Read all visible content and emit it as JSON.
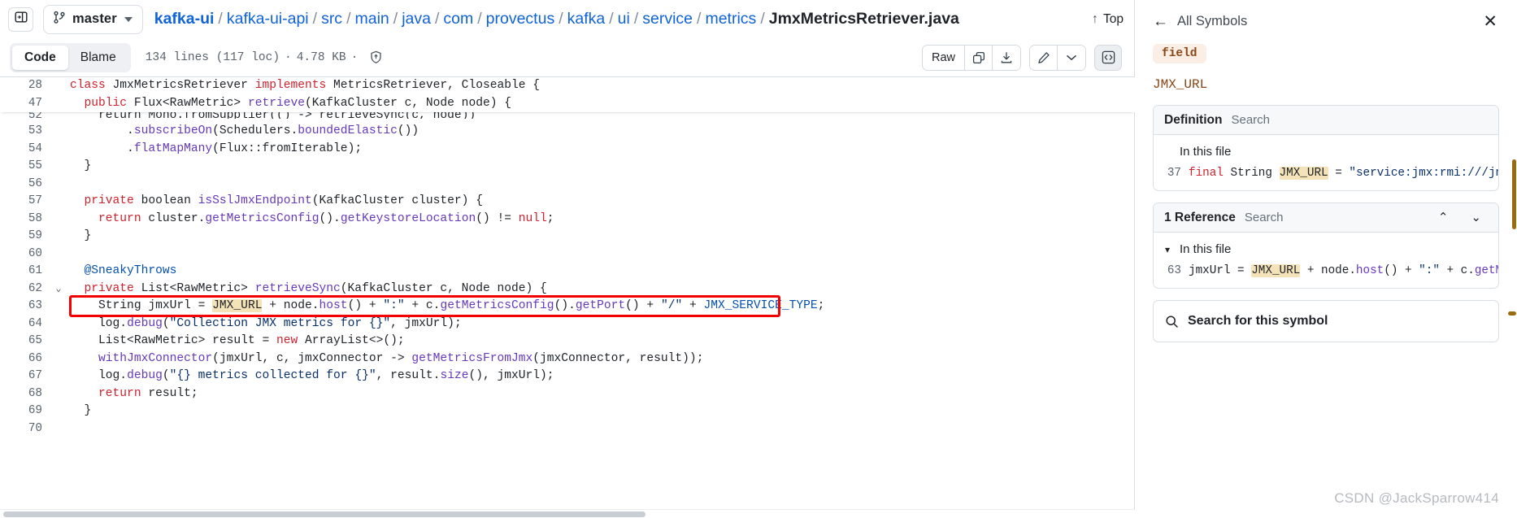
{
  "header": {
    "sidebar_toggle_icon": "sidebar-panel-icon",
    "branch": {
      "icon": "git-branch-icon",
      "name": "master",
      "caret_icon": "chevron-down-icon"
    },
    "breadcrumb": [
      {
        "label": "kafka-ui",
        "style": "bold-link"
      },
      {
        "label": "kafka-ui-api",
        "style": "link"
      },
      {
        "label": "src",
        "style": "link"
      },
      {
        "label": "main",
        "style": "link"
      },
      {
        "label": "java",
        "style": "link"
      },
      {
        "label": "com",
        "style": "link"
      },
      {
        "label": "provectus",
        "style": "link"
      },
      {
        "label": "kafka",
        "style": "link"
      },
      {
        "label": "ui",
        "style": "link"
      },
      {
        "label": "service",
        "style": "link"
      },
      {
        "label": "metrics",
        "style": "link"
      }
    ],
    "separator": "/",
    "filename": "JmxMetricsRetriever.java",
    "top_link": {
      "icon": "arrow-up-icon",
      "label": "Top"
    }
  },
  "toolbar": {
    "tabs": [
      {
        "label": "Code",
        "active": true
      },
      {
        "label": "Blame",
        "active": false
      }
    ],
    "meta": {
      "lines": "134 lines (117 loc)",
      "separator": "·",
      "size": "4.78 KB",
      "shield_icon": "shield-check-icon"
    },
    "actions": [
      {
        "name": "raw-button",
        "label": "Raw",
        "icon": null
      },
      {
        "name": "copy-raw-button",
        "label": "",
        "icon": "copy-icon"
      },
      {
        "name": "download-button",
        "label": "",
        "icon": "download-icon"
      },
      {
        "name": "edit-button",
        "label": "",
        "icon": "pencil-icon"
      },
      {
        "name": "edit-dropdown-button",
        "label": "",
        "icon": "chevron-down-icon"
      },
      {
        "name": "symbols-button",
        "label": "",
        "icon": "code-brackets-icon"
      }
    ]
  },
  "code": {
    "sticky_lines": [
      {
        "number": "28",
        "fold": "",
        "tokens": [
          {
            "t": "class ",
            "c": "k"
          },
          {
            "t": "JmxMetricsRetriever ",
            "c": "ty"
          },
          {
            "t": "implements ",
            "c": "k"
          },
          {
            "t": "MetricsRetriever, Closeable {",
            "c": "ty"
          }
        ]
      },
      {
        "number": "47",
        "fold": "",
        "tokens": [
          {
            "t": "  ",
            "c": "ty"
          },
          {
            "t": "public ",
            "c": "k"
          },
          {
            "t": "Flux<RawMetric> ",
            "c": "ty"
          },
          {
            "t": "retrieve",
            "c": "fn"
          },
          {
            "t": "(KafkaCluster c, Node node) {",
            "c": "ty"
          }
        ]
      }
    ],
    "clipped_line": {
      "number": "52",
      "tokens": [
        {
          "t": "    return Mono.fromSupplier(() -> retrieveSync(c, node))",
          "c": "ty"
        }
      ]
    },
    "lines": [
      {
        "number": "53",
        "fold": "",
        "tokens": [
          {
            "t": "        .",
            "c": "ty"
          },
          {
            "t": "subscribeOn",
            "c": "fn"
          },
          {
            "t": "(Schedulers.",
            "c": "ty"
          },
          {
            "t": "boundedElastic",
            "c": "fn"
          },
          {
            "t": "())",
            "c": "ty"
          }
        ]
      },
      {
        "number": "54",
        "fold": "",
        "tokens": [
          {
            "t": "        .",
            "c": "ty"
          },
          {
            "t": "flatMapMany",
            "c": "fn"
          },
          {
            "t": "(Flux::fromIterable);",
            "c": "ty"
          }
        ]
      },
      {
        "number": "55",
        "fold": "",
        "tokens": [
          {
            "t": "  }",
            "c": "ty"
          }
        ]
      },
      {
        "number": "56",
        "fold": "",
        "tokens": [
          {
            "t": "",
            "c": "ty"
          }
        ]
      },
      {
        "number": "57",
        "fold": "",
        "tokens": [
          {
            "t": "  ",
            "c": "ty"
          },
          {
            "t": "private ",
            "c": "k"
          },
          {
            "t": "boolean ",
            "c": "ty"
          },
          {
            "t": "isSslJmxEndpoint",
            "c": "fn"
          },
          {
            "t": "(KafkaCluster cluster) {",
            "c": "ty"
          }
        ]
      },
      {
        "number": "58",
        "fold": "",
        "tokens": [
          {
            "t": "    ",
            "c": "ty"
          },
          {
            "t": "return ",
            "c": "k"
          },
          {
            "t": "cluster.",
            "c": "ty"
          },
          {
            "t": "getMetricsConfig",
            "c": "fn"
          },
          {
            "t": "().",
            "c": "ty"
          },
          {
            "t": "getKeystoreLocation",
            "c": "fn"
          },
          {
            "t": "() != ",
            "c": "ty"
          },
          {
            "t": "null",
            "c": "k"
          },
          {
            "t": ";",
            "c": "ty"
          }
        ]
      },
      {
        "number": "59",
        "fold": "",
        "tokens": [
          {
            "t": "  }",
            "c": "ty"
          }
        ]
      },
      {
        "number": "60",
        "fold": "",
        "tokens": [
          {
            "t": "",
            "c": "ty"
          }
        ]
      },
      {
        "number": "61",
        "fold": "",
        "tokens": [
          {
            "t": "  @SneakyThrows",
            "c": "an"
          }
        ]
      },
      {
        "number": "62",
        "fold": "chevron-down",
        "tokens": [
          {
            "t": "  ",
            "c": "ty"
          },
          {
            "t": "private ",
            "c": "k"
          },
          {
            "t": "List<RawMetric> ",
            "c": "ty"
          },
          {
            "t": "retrieveSync",
            "c": "fn"
          },
          {
            "t": "(KafkaCluster c, Node node) {",
            "c": "ty"
          }
        ]
      },
      {
        "number": "63",
        "fold": "",
        "boxed": true,
        "tokens": [
          {
            "t": "    String jmxUrl = ",
            "c": "ty"
          },
          {
            "t": "JMX_URL",
            "c": "ty hl"
          },
          {
            "t": " + node.",
            "c": "ty"
          },
          {
            "t": "host",
            "c": "fn"
          },
          {
            "t": "() + ",
            "c": "ty"
          },
          {
            "t": "\":\"",
            "c": "s"
          },
          {
            "t": " + c.",
            "c": "ty"
          },
          {
            "t": "getMetricsConfig",
            "c": "fn"
          },
          {
            "t": "().",
            "c": "ty"
          },
          {
            "t": "getPort",
            "c": "fn"
          },
          {
            "t": "() + ",
            "c": "ty"
          },
          {
            "t": "\"/\"",
            "c": "s"
          },
          {
            "t": " + ",
            "c": "ty"
          },
          {
            "t": "JMX_SERVICE_TYPE",
            "c": "an"
          },
          {
            "t": ";",
            "c": "ty"
          }
        ]
      },
      {
        "number": "64",
        "fold": "",
        "tokens": [
          {
            "t": "    log.",
            "c": "ty"
          },
          {
            "t": "debug",
            "c": "fn"
          },
          {
            "t": "(",
            "c": "ty"
          },
          {
            "t": "\"Collection JMX metrics for {}\"",
            "c": "s"
          },
          {
            "t": ", jmxUrl);",
            "c": "ty"
          }
        ]
      },
      {
        "number": "65",
        "fold": "",
        "tokens": [
          {
            "t": "    List<RawMetric> result = ",
            "c": "ty"
          },
          {
            "t": "new ",
            "c": "k"
          },
          {
            "t": "ArrayList<>();",
            "c": "ty"
          }
        ]
      },
      {
        "number": "66",
        "fold": "",
        "tokens": [
          {
            "t": "    ",
            "c": "ty"
          },
          {
            "t": "withJmxConnector",
            "c": "fn"
          },
          {
            "t": "(jmxUrl, c, jmxConnector -> ",
            "c": "ty"
          },
          {
            "t": "getMetricsFromJmx",
            "c": "fn"
          },
          {
            "t": "(jmxConnector, result));",
            "c": "ty"
          }
        ]
      },
      {
        "number": "67",
        "fold": "",
        "tokens": [
          {
            "t": "    log.",
            "c": "ty"
          },
          {
            "t": "debug",
            "c": "fn"
          },
          {
            "t": "(",
            "c": "ty"
          },
          {
            "t": "\"{} metrics collected for {}\"",
            "c": "s"
          },
          {
            "t": ", result.",
            "c": "ty"
          },
          {
            "t": "size",
            "c": "fn"
          },
          {
            "t": "(), jmxUrl);",
            "c": "ty"
          }
        ]
      },
      {
        "number": "68",
        "fold": "",
        "tokens": [
          {
            "t": "    ",
            "c": "ty"
          },
          {
            "t": "return ",
            "c": "k"
          },
          {
            "t": "result;",
            "c": "ty"
          }
        ]
      },
      {
        "number": "69",
        "fold": "",
        "tokens": [
          {
            "t": "  }",
            "c": "ty"
          }
        ]
      },
      {
        "number": "70",
        "fold": "",
        "tokens": [
          {
            "t": "",
            "c": "ty"
          }
        ]
      }
    ]
  },
  "panel": {
    "back_icon": "arrow-left-icon",
    "back_label": "All Symbols",
    "close_icon": "close-icon",
    "kind_badge": "field",
    "symbol_name": "JMX_URL",
    "definition": {
      "title": "Definition",
      "search_label": "Search",
      "group_label": "In this file",
      "group_chevron": "",
      "snippet": {
        "line": "37",
        "parts": [
          {
            "t": "final ",
            "c": "k"
          },
          {
            "t": "String ",
            "c": "ty"
          },
          {
            "t": "JMX_URL",
            "c": "ty hl"
          },
          {
            "t": " = ",
            "c": "ty"
          },
          {
            "t": "\"service:jmx:rmi:///jndi/",
            "c": "s"
          }
        ]
      }
    },
    "references": {
      "title": "1 Reference",
      "search_label": "Search",
      "up_icon": "chevron-up-icon",
      "down_icon": "chevron-down-icon",
      "group_label": "In this file",
      "group_chevron": "chevron-down-icon",
      "snippet": {
        "line": "63",
        "parts": [
          {
            "t": "jmxUrl = ",
            "c": "ty"
          },
          {
            "t": "JMX_URL",
            "c": "ty hl"
          },
          {
            "t": " + node.",
            "c": "ty"
          },
          {
            "t": "host",
            "c": "fn"
          },
          {
            "t": "() + ",
            "c": "ty"
          },
          {
            "t": "\":\"",
            "c": "s"
          },
          {
            "t": " + c.",
            "c": "ty"
          },
          {
            "t": "getMetr",
            "c": "fn"
          }
        ]
      }
    },
    "search_symbol": {
      "icon": "search-icon",
      "label": "Search for this symbol"
    }
  },
  "watermark": "CSDN @JackSparrow414",
  "colors": {
    "link": "#1063d8",
    "keyword": "#cf222e",
    "function": "#6639ba",
    "string": "#0a3069",
    "highlight": "#f4e2b8",
    "box": "#f40000",
    "badge_bg": "#fbeee4",
    "badge_fg": "#8a4614"
  }
}
